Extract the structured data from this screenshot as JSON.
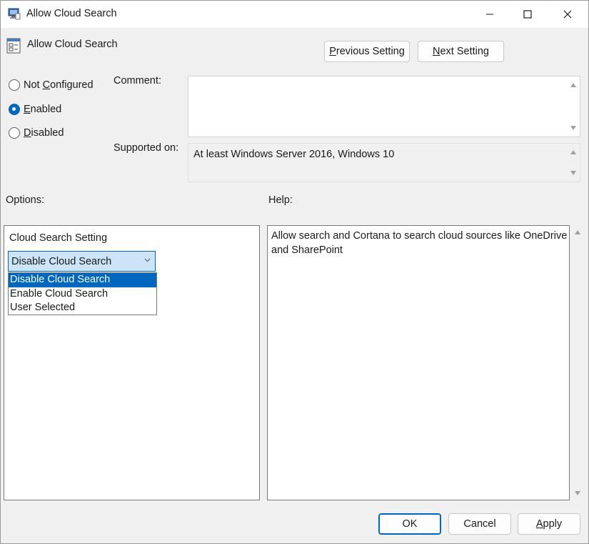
{
  "window": {
    "title": "Allow Cloud Search",
    "controls": [
      "minimize-icon",
      "maximize-icon",
      "close-icon"
    ]
  },
  "header": {
    "policy_title": "Allow Cloud Search",
    "previous_button": {
      "pre": "",
      "accel": "P",
      "post": "revious Setting"
    },
    "next_button": {
      "pre": "",
      "accel": "N",
      "post": "ext Setting"
    }
  },
  "state": {
    "options": [
      {
        "pre": "Not ",
        "accel": "C",
        "post": "onfigured",
        "checked": false
      },
      {
        "pre": "",
        "accel": "E",
        "post": "nabled",
        "checked": true
      },
      {
        "pre": "",
        "accel": "D",
        "post": "isabled",
        "checked": false
      }
    ]
  },
  "comment": {
    "label": "Comment:",
    "value": ""
  },
  "supported": {
    "label": "Supported on:",
    "value": "At least Windows Server 2016, Windows 10"
  },
  "options_section": {
    "label": "Options:",
    "setting_label": "Cloud Search Setting",
    "selected": "Disable Cloud Search",
    "items": [
      "Disable Cloud Search",
      "Enable Cloud Search",
      "User Selected"
    ]
  },
  "help_section": {
    "label": "Help:",
    "text_line1": "Allow search and Cortana to search cloud sources like OneDrive",
    "text_line2": "and SharePoint"
  },
  "footer": {
    "ok": "OK",
    "cancel": "Cancel",
    "apply": {
      "pre": "",
      "accel": "A",
      "post": "pply"
    }
  },
  "colors": {
    "accent": "#0067c0",
    "selection_bg": "#cce4f7",
    "window_bg": "#f0f0f0"
  }
}
